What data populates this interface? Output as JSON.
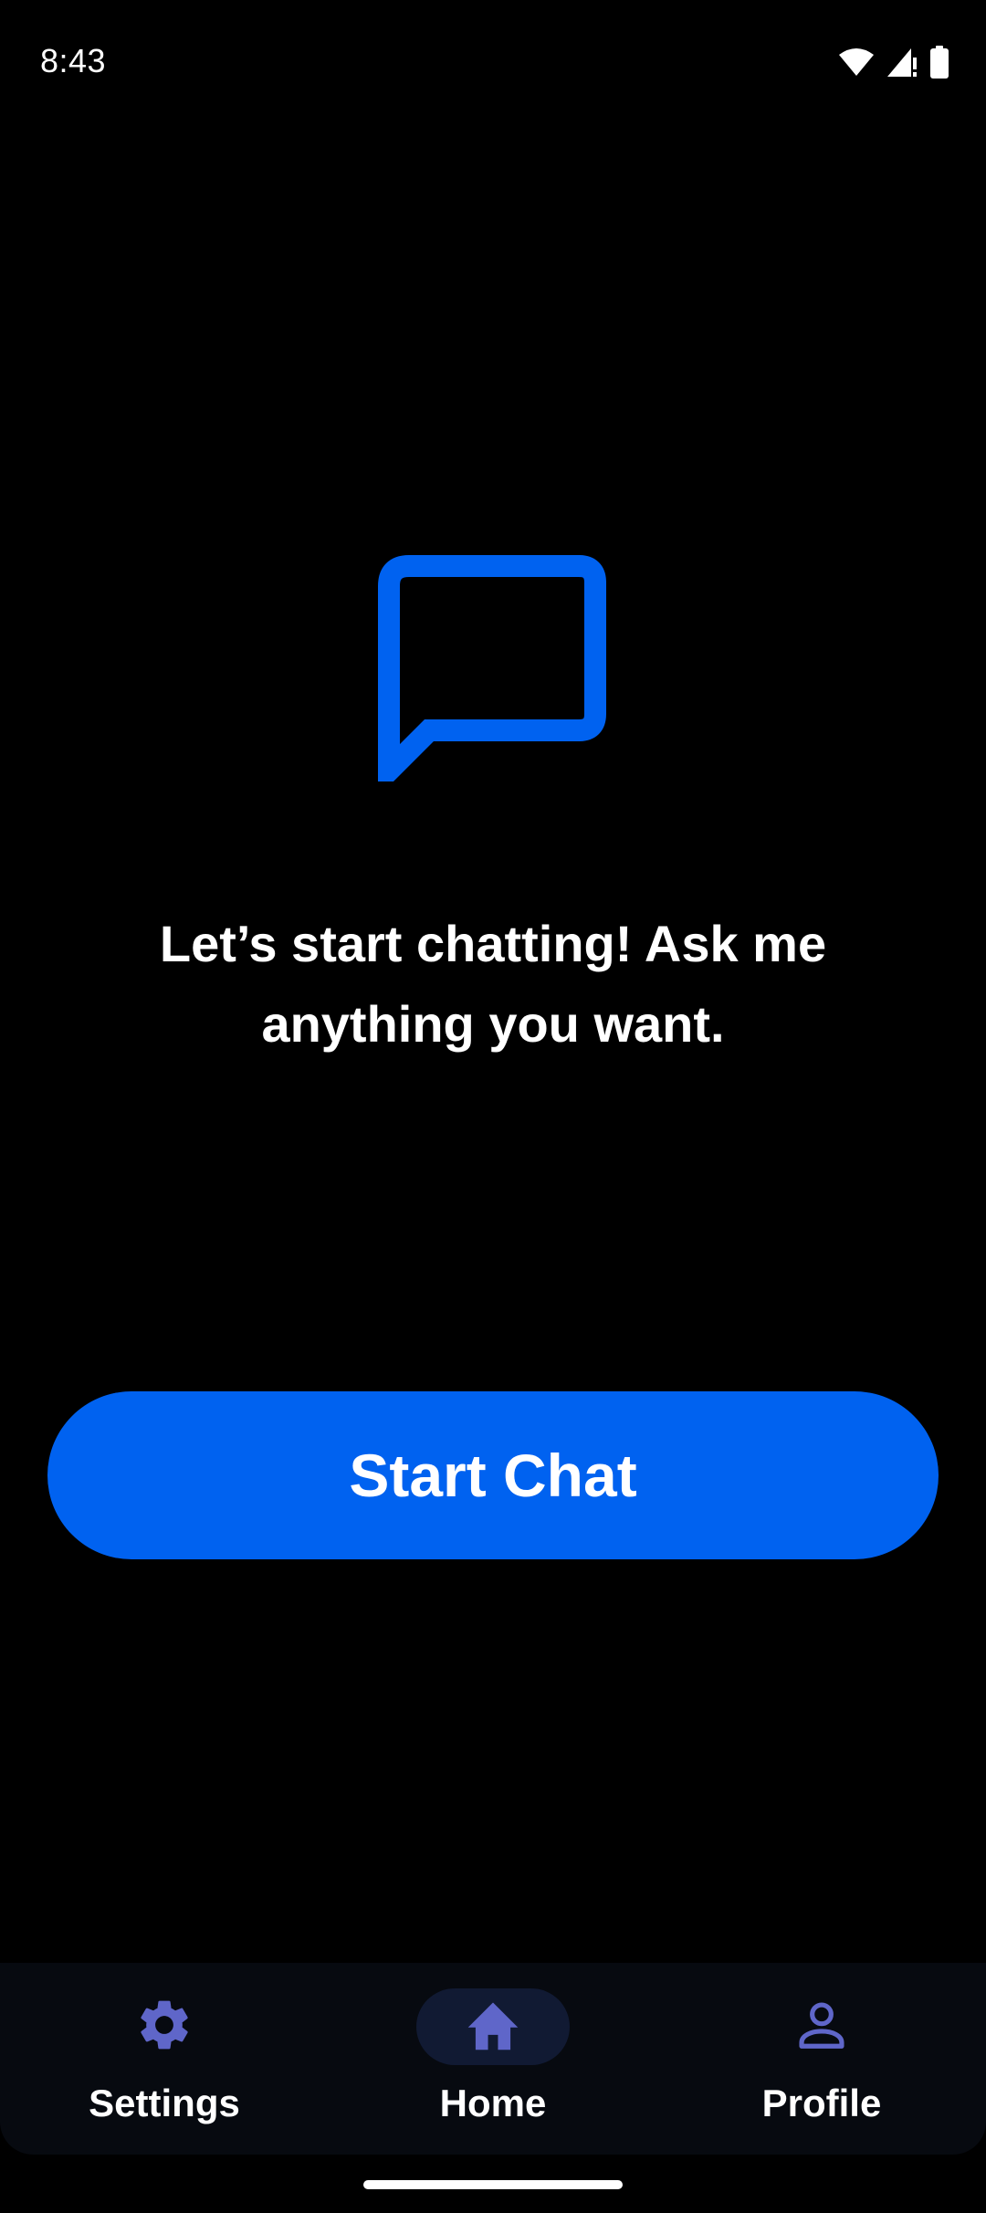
{
  "status_bar": {
    "time": "8:43",
    "icons": [
      "wifi-icon",
      "cell-signal-icon",
      "battery-icon"
    ]
  },
  "main": {
    "hero_icon": "chat-bubble-icon",
    "welcome_text": "Let’s start chatting! Ask me anything you want.",
    "start_button_label": "Start Chat"
  },
  "bottom_nav": {
    "items": [
      {
        "label": "Settings",
        "icon": "gear-icon",
        "active": false
      },
      {
        "label": "Home",
        "icon": "home-icon",
        "active": true
      },
      {
        "label": "Profile",
        "icon": "person-icon",
        "active": false
      }
    ]
  },
  "colors": {
    "background": "#000000",
    "accent": "#0062f0",
    "nav_icon": "#5f66c9",
    "nav_active_pill": "#111a33",
    "nav_background": "#070a10"
  }
}
